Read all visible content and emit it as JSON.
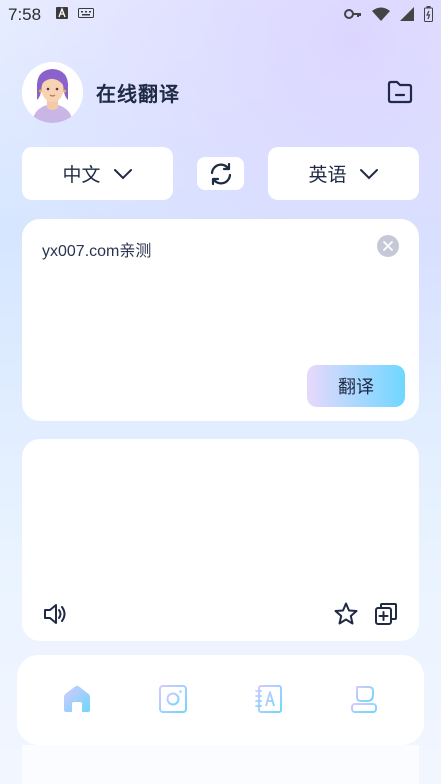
{
  "status": {
    "time": "7:58"
  },
  "header": {
    "title": "在线翻译"
  },
  "languages": {
    "source": "中文",
    "target": "英语"
  },
  "input": {
    "text": "yx007.com亲测",
    "translate_label": "翻译"
  },
  "colors": {
    "accent": "#6fd7ff",
    "text": "#1f2a44"
  },
  "icons": [
    "avatar",
    "folder-icon",
    "swap-icon",
    "clear-icon",
    "speaker-icon",
    "star-icon",
    "copy-icon",
    "home-icon",
    "camera-icon",
    "dictionary-icon",
    "profile-icon"
  ]
}
